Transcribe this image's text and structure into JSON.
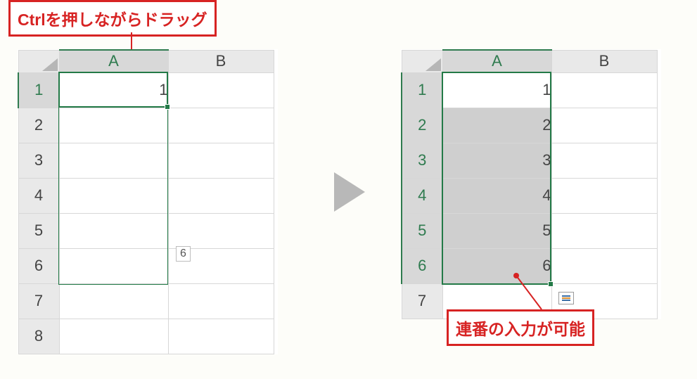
{
  "callouts": {
    "top": "Ctrlを押しながらドラッグ",
    "bottom": "連番の入力が可能"
  },
  "columns": [
    "A",
    "B"
  ],
  "rows_left": [
    "1",
    "2",
    "3",
    "4",
    "5",
    "6",
    "7",
    "8"
  ],
  "rows_right": [
    "1",
    "2",
    "3",
    "4",
    "5",
    "6",
    "7"
  ],
  "left_sheet": {
    "A1": "1"
  },
  "right_sheet": {
    "A1": "1",
    "A2": "2",
    "A3": "3",
    "A4": "4",
    "A5": "5",
    "A6": "6"
  },
  "drag_tooltip": "6"
}
